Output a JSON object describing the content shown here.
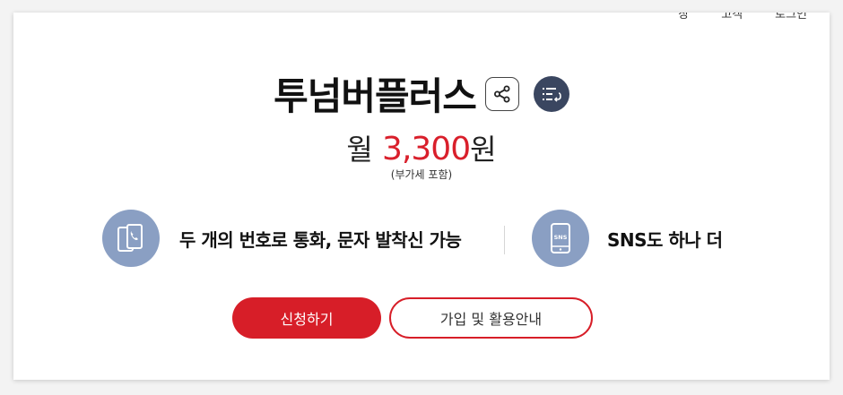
{
  "header": {
    "crumbs": [
      "장",
      "고객",
      "로그인"
    ]
  },
  "plan": {
    "title": "투넘버플러스",
    "price_prefix": "월",
    "price_amount": "3,300",
    "price_suffix": "원",
    "vat_note": "(부가세 포함)"
  },
  "icons": {
    "share": "share-icon",
    "list": "list-icon",
    "feature1": "phone-icon",
    "feature2": "sns-phone-icon"
  },
  "features": [
    {
      "label": "두 개의 번호로 통화, 문자 발착신 가능"
    },
    {
      "label": "SNS도 하나 더",
      "icon_text": "SNS"
    }
  ],
  "buttons": {
    "apply": "신청하기",
    "guide": "가입 및 활용안내"
  },
  "colors": {
    "accent": "#d71e28",
    "icon_bg": "#8a9fc3",
    "list_btn": "#3a4660"
  }
}
